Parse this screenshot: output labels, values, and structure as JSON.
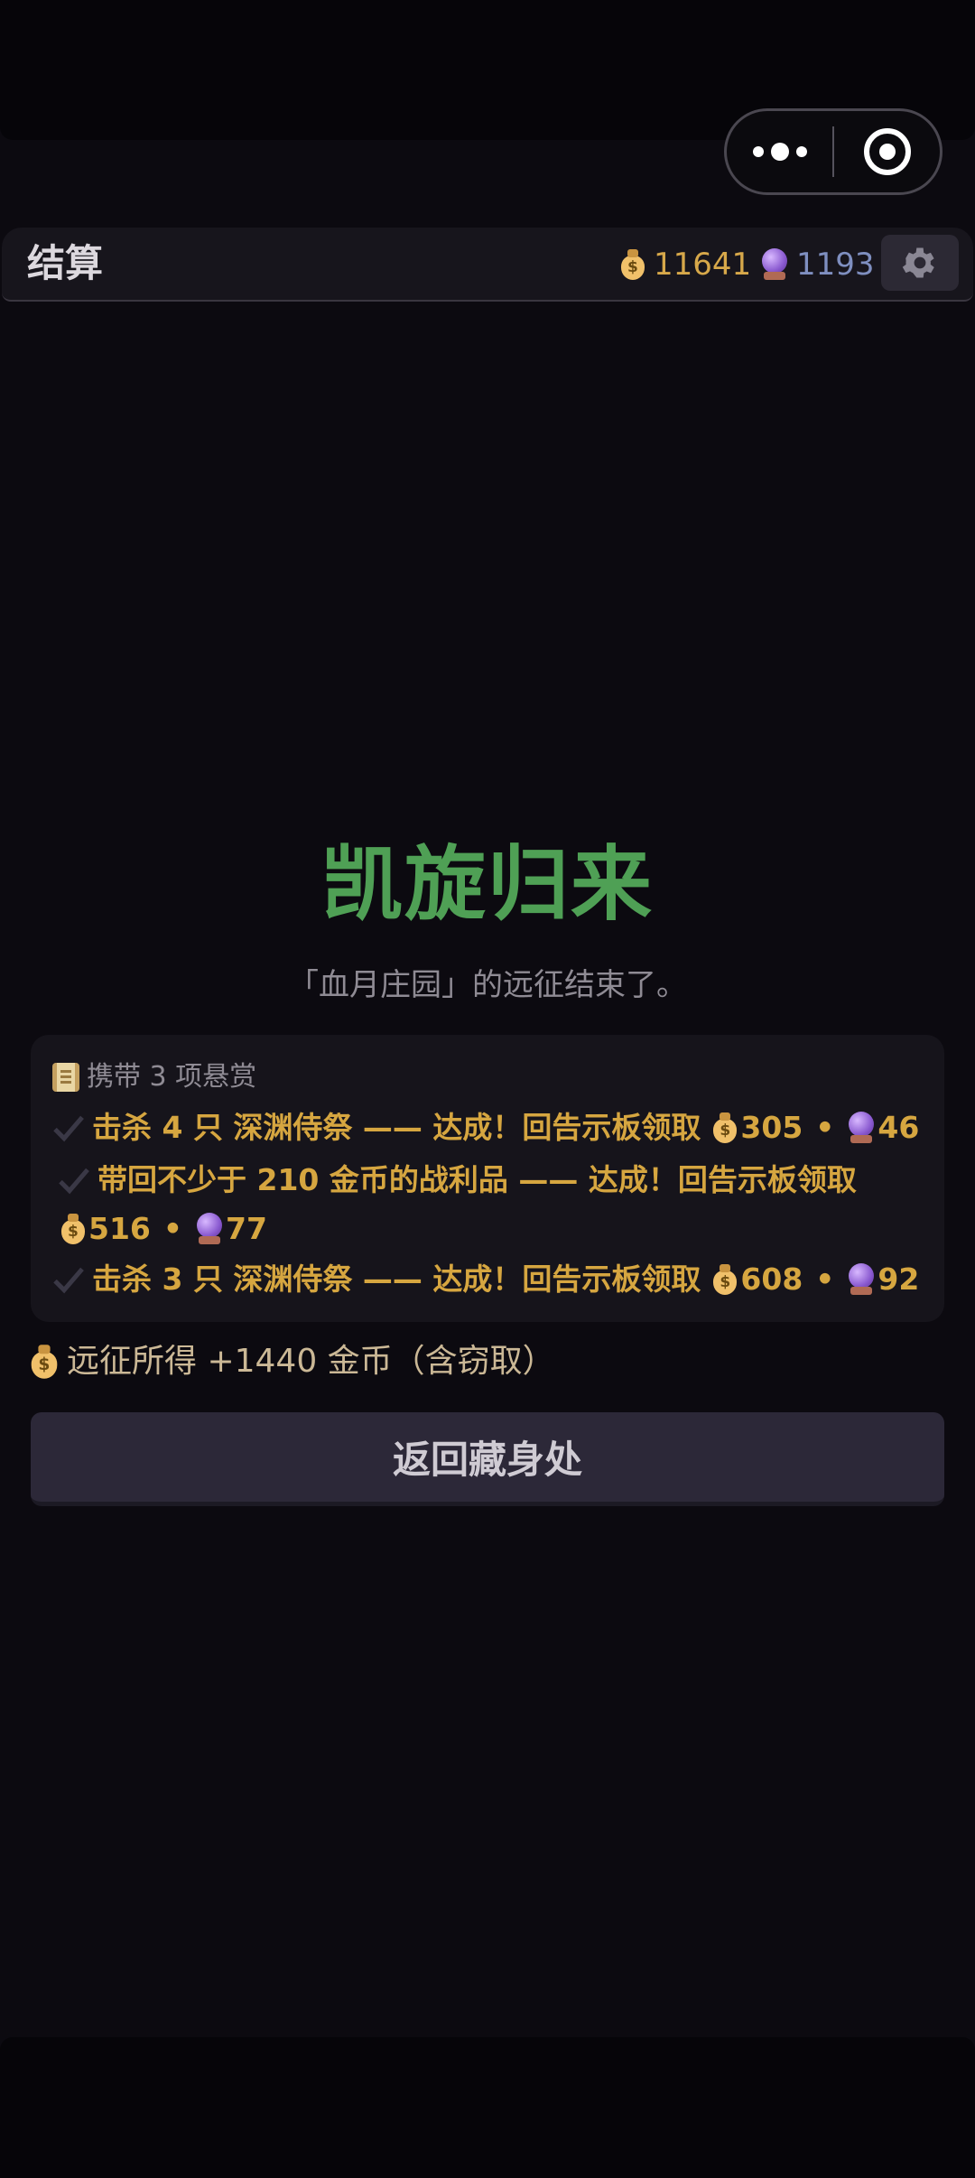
{
  "header": {
    "title": "结算",
    "gold": "11641",
    "orbs": "1193"
  },
  "result": {
    "headline": "凯旋归来",
    "subtitle": "「血月庄园」的远征结束了。"
  },
  "bounties": {
    "heading": "携带 3 项悬赏",
    "items": [
      {
        "text": "击杀 4 只 深渊侍祭 —— 达成！回告示板领取",
        "gold": "305",
        "orbs": "46"
      },
      {
        "text": "带回不少于 210 金币的战利品 —— 达成！回告示板领取",
        "gold": "516",
        "orbs": "77"
      },
      {
        "text": "击杀 3 只 深渊侍祭 —— 达成！回告示板领取",
        "gold": "608",
        "orbs": "92"
      }
    ],
    "separator": "•"
  },
  "summary": {
    "text": "远征所得 +1440 金币（含窃取）"
  },
  "actions": {
    "return_label": "返回藏身处"
  },
  "colors": {
    "background": "#0c0a10",
    "victory_green": "#4fa055",
    "bounty_gold": "#d6a640",
    "gold_text": "#d7a84a",
    "orb_text": "#7f8fc0"
  }
}
